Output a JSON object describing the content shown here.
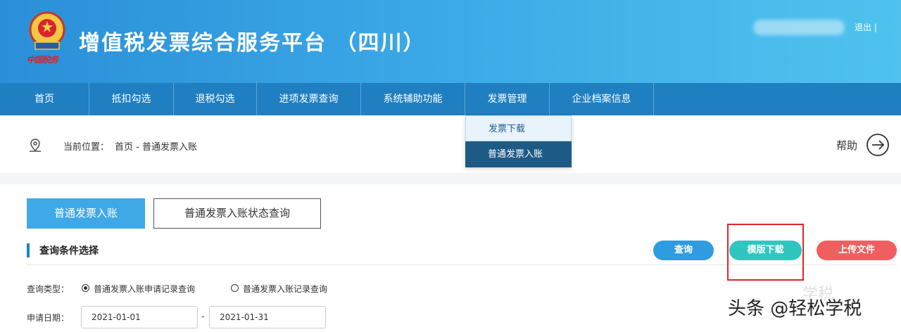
{
  "header": {
    "title": "增值税发票综合服务平台 （四川）",
    "emblem_caption": "中国税务",
    "logout": "退出 |"
  },
  "nav": {
    "items": [
      {
        "label": "首页",
        "width": 127
      },
      {
        "label": "抵扣勾选",
        "width": 120
      },
      {
        "label": "退税勾选",
        "width": 118
      },
      {
        "label": "进项发票查询",
        "width": 148
      },
      {
        "label": "系统辅助功能",
        "width": 148
      },
      {
        "label": "发票管理",
        "width": 120
      },
      {
        "label": "企业档案信息",
        "width": 148
      }
    ]
  },
  "dropdown": {
    "items": [
      "发票下载",
      "普通发票入账"
    ]
  },
  "breadcrumb": {
    "label": "当前位置：",
    "path": "首页 - 普通发票入账",
    "help": "帮助"
  },
  "tabs": {
    "primary": "普通发票入账",
    "secondary": "普通发票入账状态查询"
  },
  "section": {
    "title": "查询条件选择"
  },
  "actions": {
    "query": "查询",
    "download_template": "模版下载",
    "upload_file": "上传文件"
  },
  "form": {
    "query_type_label": "查询类型：",
    "radio_options": [
      "普通发票入账申请记录查询",
      "普通发票入账记录查询"
    ],
    "date_label": "申请日期：",
    "date_from": "2021-01-01",
    "date_sep": "-",
    "date_to": "2021-01-31"
  },
  "watermark": {
    "text": "头条 @轻松学税",
    "ghost": "学税"
  },
  "colors": {
    "header_start": "#2a8fd8",
    "nav": "#1f7fc1",
    "primary_tab": "#3ea9e6",
    "query_btn": "#2f9be0",
    "download_btn": "#2fc6c0",
    "upload_btn": "#ef5f5f",
    "highlight": "#e4232a"
  }
}
